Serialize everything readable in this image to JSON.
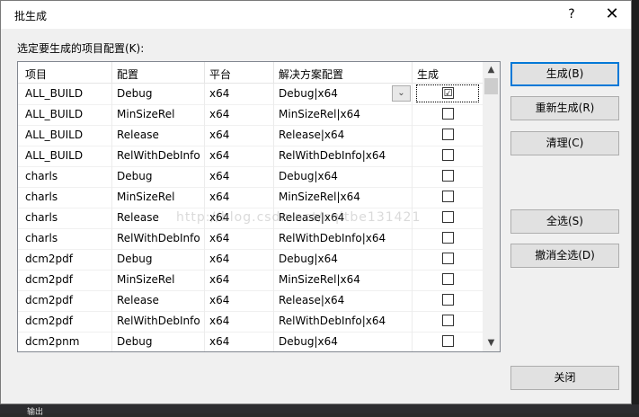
{
  "window": {
    "title": "批生成",
    "help_label": "?",
    "close_label": "✕"
  },
  "prompt_label": "选定要生成的项目配置(K):",
  "columns": [
    "项目",
    "配置",
    "平台",
    "解决方案配置",
    "生成"
  ],
  "rows": [
    {
      "project": "ALL_BUILD",
      "config": "Debug",
      "platform": "x64",
      "solution": "Debug|x64",
      "checked": "☑"
    },
    {
      "project": "ALL_BUILD",
      "config": "MinSizeRel",
      "platform": "x64",
      "solution": "MinSizeRel|x64",
      "checked": ""
    },
    {
      "project": "ALL_BUILD",
      "config": "Release",
      "platform": "x64",
      "solution": "Release|x64",
      "checked": ""
    },
    {
      "project": "ALL_BUILD",
      "config": "RelWithDebInfo",
      "platform": "x64",
      "solution": "RelWithDebInfo|x64",
      "checked": ""
    },
    {
      "project": "charls",
      "config": "Debug",
      "platform": "x64",
      "solution": "Debug|x64",
      "checked": ""
    },
    {
      "project": "charls",
      "config": "MinSizeRel",
      "platform": "x64",
      "solution": "MinSizeRel|x64",
      "checked": ""
    },
    {
      "project": "charls",
      "config": "Release",
      "platform": "x64",
      "solution": "Release|x64",
      "checked": ""
    },
    {
      "project": "charls",
      "config": "RelWithDebInfo",
      "platform": "x64",
      "solution": "RelWithDebInfo|x64",
      "checked": ""
    },
    {
      "project": "dcm2pdf",
      "config": "Debug",
      "platform": "x64",
      "solution": "Debug|x64",
      "checked": ""
    },
    {
      "project": "dcm2pdf",
      "config": "MinSizeRel",
      "platform": "x64",
      "solution": "MinSizeRel|x64",
      "checked": ""
    },
    {
      "project": "dcm2pdf",
      "config": "Release",
      "platform": "x64",
      "solution": "Release|x64",
      "checked": ""
    },
    {
      "project": "dcm2pdf",
      "config": "RelWithDebInfo",
      "platform": "x64",
      "solution": "RelWithDebInfo|x64",
      "checked": ""
    },
    {
      "project": "dcm2pnm",
      "config": "Debug",
      "platform": "x64",
      "solution": "Debug|x64",
      "checked": ""
    }
  ],
  "buttons": {
    "build": "生成(B)",
    "rebuild": "重新生成(R)",
    "clean": "清理(C)",
    "select_all": "全选(S)",
    "deselect_all": "撤消全选(D)",
    "close": "关闭"
  },
  "watermark": "http://blog.csdn.net/cqltbe131421",
  "bottom_label": "输出",
  "colors": {
    "accent": "#0078d7"
  }
}
